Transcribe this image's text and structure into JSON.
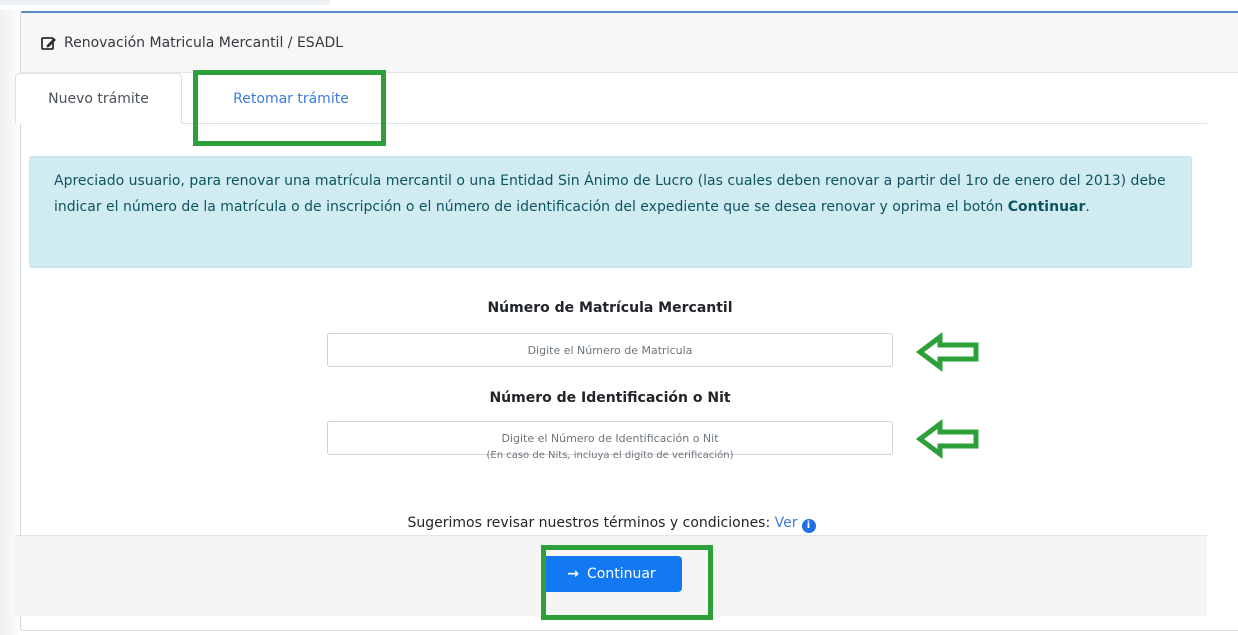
{
  "header": {
    "title": "Renovación Matricula Mercantil / ESADL",
    "icon": "edit-icon"
  },
  "tabs": [
    {
      "label": "Nuevo trámite",
      "active": true
    },
    {
      "label": "Retomar trámite",
      "active": false
    }
  ],
  "alert": {
    "text": "Apreciado usuario, para renovar una matrícula mercantil o una Entidad Sin Ánimo de Lucro (las cuales deben renovar a partir del 1ro de enero del 2013) debe indicar el número de la matrícula o de inscripción o el número de identificación del expediente que se desea renovar y oprima el botón ",
    "strong": "Continuar",
    "end": "."
  },
  "form": {
    "matricula_label": "Número de Matrícula Mercantil",
    "matricula_placeholder": "Digite el Número de Matricula",
    "matricula_value": "",
    "id_label": "Número de Identificación o Nit",
    "id_placeholder": "Digite el Número de Identificación o Nit",
    "id_value": "",
    "hint": "(En caso de Nits, incluya el digito de verificación)"
  },
  "terms": {
    "text": "Sugerimos revisar nuestros términos y condiciones: ",
    "link": "Ver",
    "info_icon": "i"
  },
  "actions": {
    "continue_label": "Continuar",
    "continue_icon": "→"
  },
  "colors": {
    "highlight": "#2ea03a",
    "primary": "#1279f2",
    "link": "#3b7ddd",
    "alert_bg": "#d1ecf1"
  }
}
